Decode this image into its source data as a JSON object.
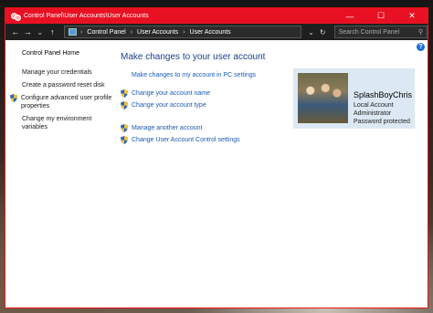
{
  "window": {
    "title": "Control Panel\\User Accounts\\User Accounts",
    "minimize": "—",
    "maximize": "☐",
    "close": "✕"
  },
  "address": {
    "crumbs": [
      "Control Panel",
      "User Accounts",
      "User Accounts"
    ],
    "search_placeholder": "Search Control Panel"
  },
  "sidebar": {
    "home": "Control Panel Home",
    "items": [
      {
        "label": "Manage your credentials",
        "shield": false
      },
      {
        "label": "Create a password reset disk",
        "shield": false
      },
      {
        "label": "Configure advanced user profile properties",
        "shield": true
      },
      {
        "label": "Change my environment variables",
        "shield": false
      }
    ]
  },
  "main": {
    "heading": "Make changes to your user account",
    "pc_settings_link": "Make changes to my account in PC settings",
    "links_group1": [
      "Change your account name",
      "Change your account type"
    ],
    "links_group2": [
      "Manage another account",
      "Change User Account Control settings"
    ]
  },
  "user": {
    "name": "SplashBoyChris",
    "type": "Local Account",
    "role": "Administrator",
    "status": "Password protected"
  },
  "icons": {
    "shield": "uac-shield-icon",
    "help": "help-icon"
  }
}
